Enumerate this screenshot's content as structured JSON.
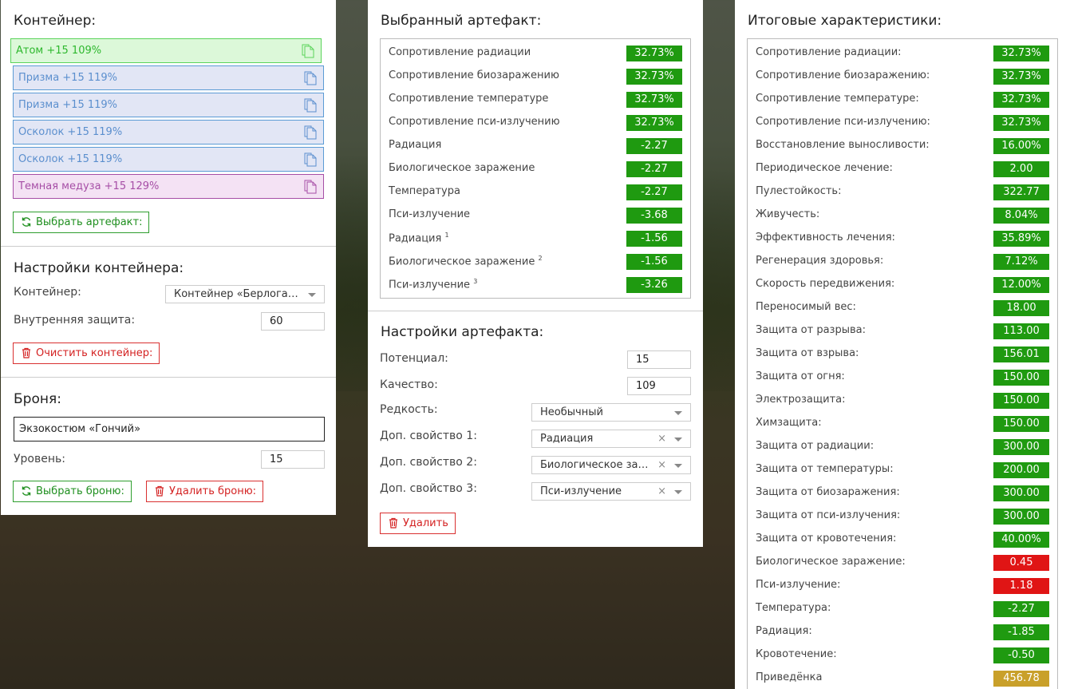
{
  "container": {
    "title": "Контейнер:",
    "artifacts": [
      {
        "label": "Атом +15 109%",
        "style": "green"
      },
      {
        "label": "Призма +15 119%",
        "style": "blue"
      },
      {
        "label": "Призма +15 119%",
        "style": "blue"
      },
      {
        "label": "Осколок +15 119%",
        "style": "blue"
      },
      {
        "label": "Осколок +15 119%",
        "style": "blue"
      },
      {
        "label": "Темная медуза +15 129%",
        "style": "purple"
      }
    ],
    "select_button": "Выбрать артефакт:"
  },
  "container_settings": {
    "title": "Настройки контейнера:",
    "container_label": "Контейнер:",
    "container_value": "Контейнер «Берлога…",
    "inner_protection_label": "Внутренняя защита:",
    "inner_protection_value": "60",
    "clear_button": "Очистить контейнер:"
  },
  "armor": {
    "title": "Броня:",
    "name": "Экзокостюм «Гончий»",
    "level_label": "Уровень:",
    "level_value": "15",
    "select_button": "Выбрать броню:",
    "delete_button": "Удалить броню:"
  },
  "selected_artifact": {
    "title": "Выбранный артефакт:",
    "rows": [
      {
        "name": "Сопротивление радиации",
        "sup": "",
        "value": "32.73%",
        "color": "green"
      },
      {
        "name": "Сопротивление биозаражению",
        "sup": "",
        "value": "32.73%",
        "color": "green"
      },
      {
        "name": "Сопротивление температуре",
        "sup": "",
        "value": "32.73%",
        "color": "green"
      },
      {
        "name": "Сопротивление пси-излучению",
        "sup": "",
        "value": "32.73%",
        "color": "green"
      },
      {
        "name": "Радиация",
        "sup": "",
        "value": "-2.27",
        "color": "green"
      },
      {
        "name": "Биологическое заражение",
        "sup": "",
        "value": "-2.27",
        "color": "green"
      },
      {
        "name": "Температура",
        "sup": "",
        "value": "-2.27",
        "color": "green"
      },
      {
        "name": "Пси-излучение",
        "sup": "",
        "value": "-3.68",
        "color": "green"
      },
      {
        "name": "Радиация",
        "sup": "1",
        "value": "-1.56",
        "color": "green"
      },
      {
        "name": "Биологическое заражение",
        "sup": "2",
        "value": "-1.56",
        "color": "green"
      },
      {
        "name": "Пси-излучение",
        "sup": "3",
        "value": "-3.26",
        "color": "green"
      }
    ]
  },
  "artifact_settings": {
    "title": "Настройки артефакта:",
    "potential_label": "Потенциал:",
    "potential_value": "15",
    "quality_label": "Качество:",
    "quality_value": "109",
    "rarity_label": "Редкость:",
    "rarity_value": "Необычный",
    "extra1_label": "Доп. свойство 1:",
    "extra1_value": "Радиация",
    "extra2_label": "Доп. свойство 2:",
    "extra2_value": "Биологическое за…",
    "extra3_label": "Доп. свойство 3:",
    "extra3_value": "Пси-излучение",
    "clear_glyph": "×",
    "delete_button": "Удалить"
  },
  "totals": {
    "title": "Итоговые характеристики:",
    "rows": [
      {
        "name": "Сопротивление радиации:",
        "value": "32.73%",
        "color": "green"
      },
      {
        "name": "Сопротивление биозаражению:",
        "value": "32.73%",
        "color": "green"
      },
      {
        "name": "Сопротивление температуре:",
        "value": "32.73%",
        "color": "green"
      },
      {
        "name": "Сопротивление пси-излучению:",
        "value": "32.73%",
        "color": "green"
      },
      {
        "name": "Восстановление выносливости:",
        "value": "16.00%",
        "color": "green"
      },
      {
        "name": "Периодическое лечение:",
        "value": "2.00",
        "color": "green"
      },
      {
        "name": "Пулестойкость:",
        "value": "322.77",
        "color": "green"
      },
      {
        "name": "Живучесть:",
        "value": "8.04%",
        "color": "green"
      },
      {
        "name": "Эффективность лечения:",
        "value": "35.89%",
        "color": "green"
      },
      {
        "name": "Регенерация здоровья:",
        "value": "7.12%",
        "color": "green"
      },
      {
        "name": "Скорость передвижения:",
        "value": "12.00%",
        "color": "green"
      },
      {
        "name": "Переносимый вес:",
        "value": "18.00",
        "color": "green"
      },
      {
        "name": "Защита от разрыва:",
        "value": "113.00",
        "color": "green"
      },
      {
        "name": "Защита от взрыва:",
        "value": "156.01",
        "color": "green"
      },
      {
        "name": "Защита от огня:",
        "value": "150.00",
        "color": "green"
      },
      {
        "name": "Электрозащита:",
        "value": "150.00",
        "color": "green"
      },
      {
        "name": "Химзащита:",
        "value": "150.00",
        "color": "green"
      },
      {
        "name": "Защита от радиации:",
        "value": "300.00",
        "color": "green"
      },
      {
        "name": "Защита от температуры:",
        "value": "200.00",
        "color": "green"
      },
      {
        "name": "Защита от биозаражения:",
        "value": "300.00",
        "color": "green"
      },
      {
        "name": "Защита от пси-излучения:",
        "value": "300.00",
        "color": "green"
      },
      {
        "name": "Защита от кровотечения:",
        "value": "40.00%",
        "color": "green"
      },
      {
        "name": "Биологическое заражение:",
        "value": "0.45",
        "color": "red"
      },
      {
        "name": "Пси-излучение:",
        "value": "1.18",
        "color": "red"
      },
      {
        "name": "Температура:",
        "value": "-2.27",
        "color": "green"
      },
      {
        "name": "Радиация:",
        "value": "-1.85",
        "color": "green"
      },
      {
        "name": "Кровотечение:",
        "value": "-0.50",
        "color": "green"
      },
      {
        "name": "Приведёнка",
        "value": "456.78",
        "color": "gold"
      }
    ]
  },
  "colors": {
    "value_green": "#1f9a10",
    "value_red": "#e01515",
    "value_gold": "#c9a02a",
    "button_green": "#1f8f1f",
    "button_red": "#d42222"
  }
}
